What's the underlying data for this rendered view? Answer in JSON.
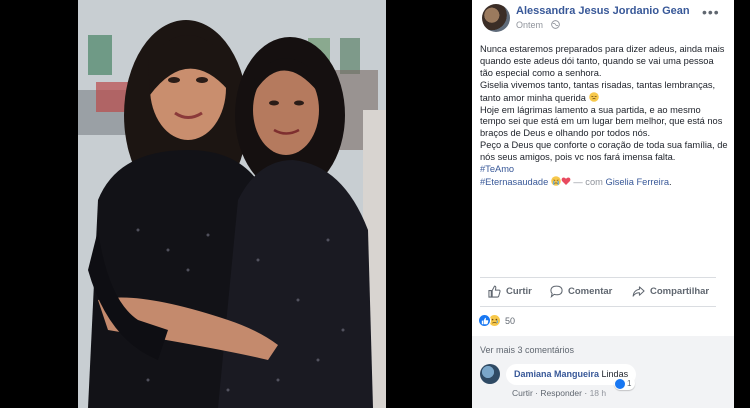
{
  "post": {
    "author": "Alessandra Jesus Jordanio Gean",
    "time": "Ontem",
    "privacy_icon": "globe-icon",
    "text_lines": [
      "Nunca estaremos preparados para dizer adeus, ainda mais quando este adeus dói tanto, quando se vai uma pessoa tão especial como a senhora.",
      "Giselia vivemos tanto, tantas risadas, tantas lembranças, tanto amor minha querida",
      "Hoje em lágrimas lamento a sua partida, e ao mesmo tempo sei que está em um lugar bem melhor, que está nos braços de Deus e olhando por todos nós.",
      "Peço a Deus que conforte o coração de toda sua família, de nós seus amigos, pois vc nos fará imensa falta."
    ],
    "hashtag1": "#TeAmo",
    "hashtag2": "#Eternasaudade",
    "with_text": "— com",
    "tagged": "Giselia Ferreira",
    "tagged_end": "."
  },
  "actions": {
    "like": "Curtir",
    "comment": "Comentar",
    "share": "Compartilhar"
  },
  "reactions": {
    "count": "50",
    "icons": [
      "like-icon",
      "sad-icon"
    ]
  },
  "comments": {
    "view_more": "Ver mais 3 comentários",
    "items": [
      {
        "author": "Damiana Mangueira",
        "text": "Lindas",
        "reaction_count": "1",
        "like": "Curtir",
        "reply": "Responder",
        "time": "18 h",
        "separator": "·"
      }
    ]
  },
  "colors": {
    "link": "#385898",
    "secondary": "#90949c",
    "action": "#606770",
    "like_blue": "#1877f2"
  }
}
